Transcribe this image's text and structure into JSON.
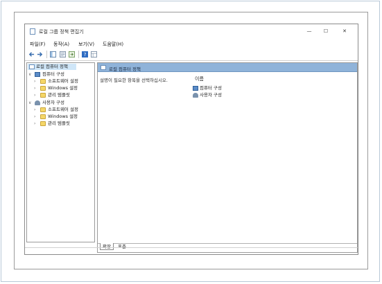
{
  "window": {
    "title": "로컬 그룹 정책 편집기",
    "minimize": "—",
    "maximize": "☐",
    "close": "✕"
  },
  "menu": [
    "파일(F)",
    "동작(A)",
    "보기(V)",
    "도움말(H)"
  ],
  "toolbar_icons": [
    "back-arrow-icon",
    "forward-arrow-icon",
    "show-tree-icon",
    "properties-icon",
    "export-list-icon",
    "help-icon",
    "view-icon"
  ],
  "tree": {
    "root": "로컬 컴퓨터 정책",
    "computer_config": "컴퓨터 구성",
    "computer_children": [
      "소프트웨어 설정",
      "Windows 설정",
      "관리 템플릿"
    ],
    "user_config": "사용자 구성",
    "user_children": [
      "소프트웨어 설정",
      "Windows 설정",
      "관리 템플릿"
    ]
  },
  "right": {
    "header": "로컬 컴퓨터 정책",
    "description": "설명이 필요한 항목을 선택하십시오.",
    "column_name": "이름",
    "items": [
      "컴퓨터 구성",
      "사용자 구성"
    ]
  },
  "tabs": [
    "확장",
    "표준"
  ],
  "colors": {
    "header_bg": "#8fb3d9",
    "selected_bg": "#cfe6f8",
    "folder": "#f5d769"
  }
}
